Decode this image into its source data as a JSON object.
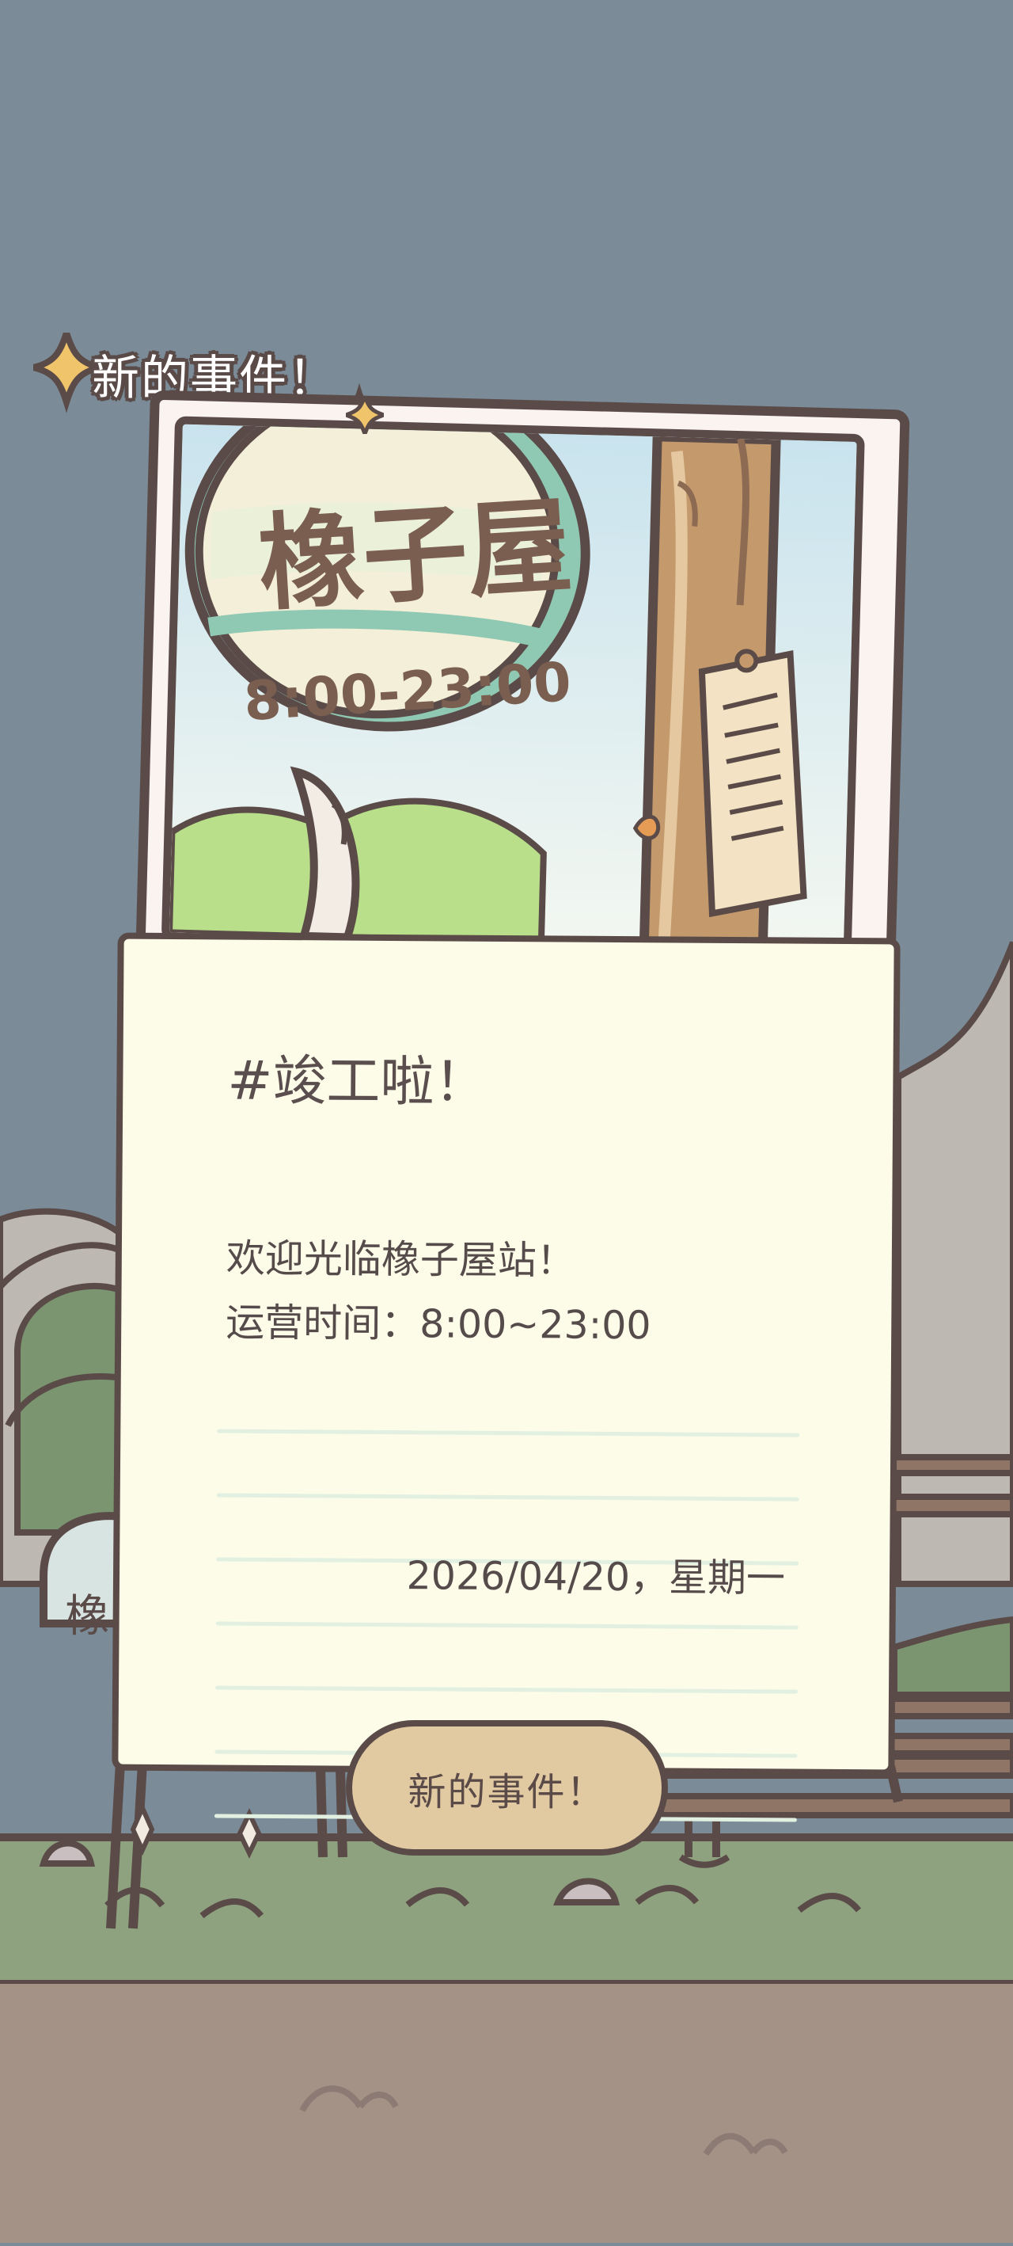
{
  "header": {
    "label": "新的事件！"
  },
  "photo": {
    "sign_title": "橡子屋",
    "sign_hours": "8:00-23:00"
  },
  "note": {
    "title": "#竣工啦！",
    "lines": [
      "欢迎光临橡子屋站！",
      "运营时间：8:00~23:00"
    ],
    "date": "2026/04/20，星期一"
  },
  "button": {
    "label": "新的事件！"
  },
  "colors": {
    "sky": "#7b8b98",
    "paper": "#fdfce8",
    "photo_frame": "#fbf3ef",
    "ink": "#5a4b48",
    "button_fill": "#e1c9a1",
    "ruled_line": "#e2f0e2",
    "grass": "#8ea27f",
    "ground": "#a59286",
    "tree": "#7a9570"
  },
  "icons": {
    "header_sparkle": "sparkle-icon",
    "photo_sparkle": "sparkle-icon"
  }
}
